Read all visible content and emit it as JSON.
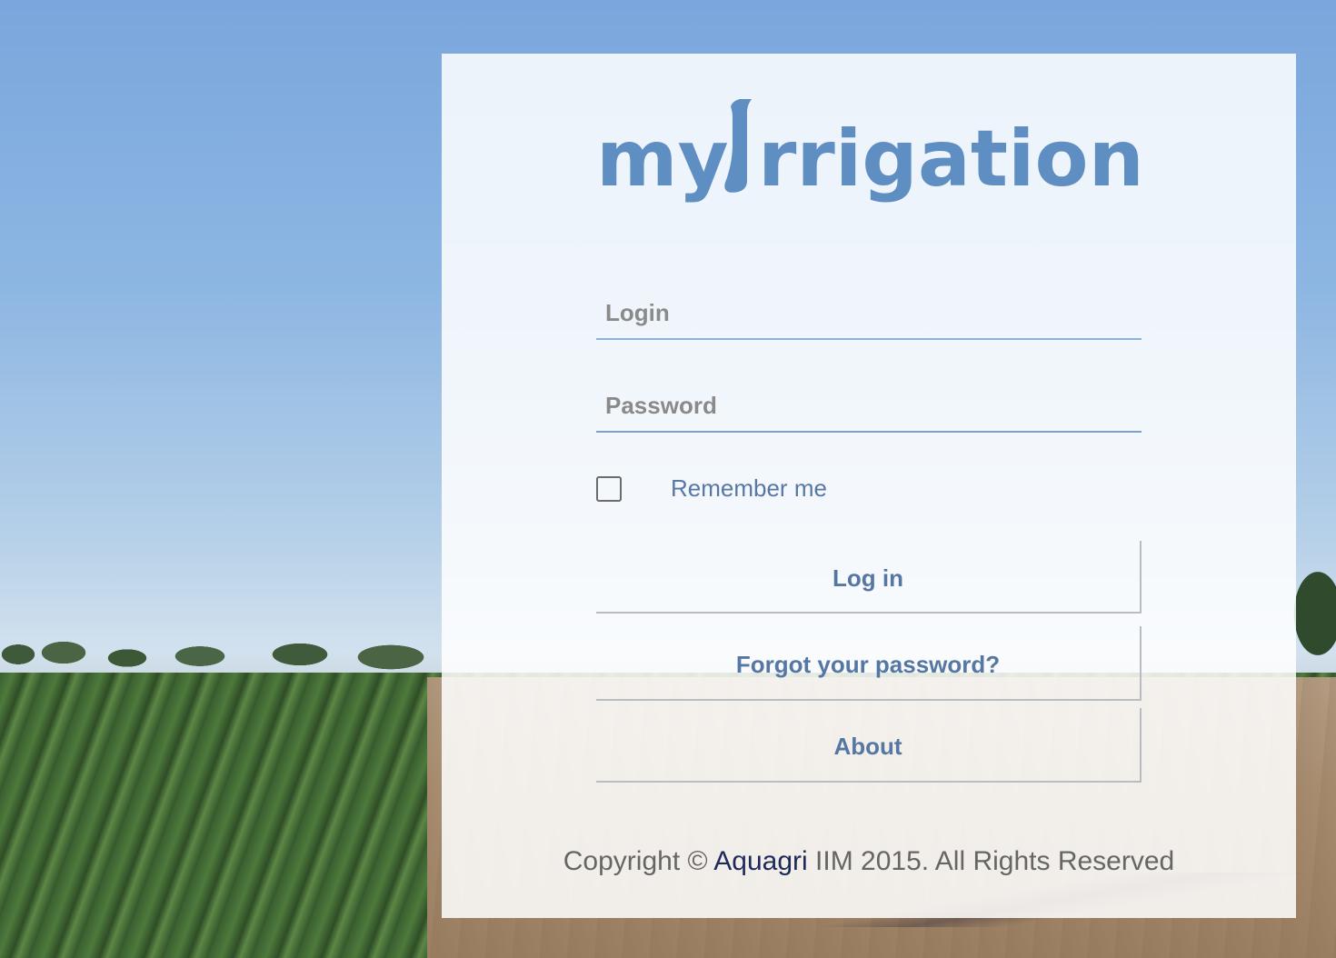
{
  "logo": {
    "text": "myirrigation",
    "color": "#5f8fc2"
  },
  "form": {
    "login_placeholder": "Login",
    "login_value": "",
    "password_placeholder": "Password",
    "password_value": "",
    "remember_label": "Remember me",
    "remember_checked": false
  },
  "buttons": {
    "login": "Log in",
    "forgot": "Forgot your password?",
    "about": "About"
  },
  "footer": {
    "prefix": "Copyright © ",
    "brand": "Aquagri",
    "suffix": " IIM 2015. All Rights Reserved"
  },
  "colors": {
    "accent": "#5676a3",
    "underline": "#8fb3d8",
    "brand_link": "#1f2a5a"
  }
}
